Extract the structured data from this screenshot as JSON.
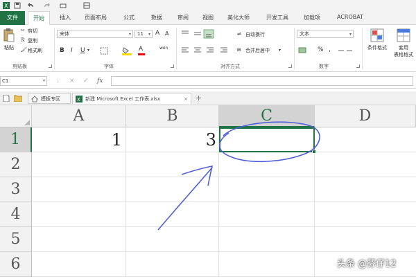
{
  "quick_access": {
    "save_icon": "save-icon",
    "undo_icon": "undo-icon",
    "redo_icon": "redo-icon",
    "extra_icon": "customize-icon"
  },
  "ribbon_tabs": [
    "文件",
    "开始",
    "插入",
    "页面布局",
    "公式",
    "数据",
    "审阅",
    "视图",
    "美化大师",
    "开发工具",
    "加载项",
    "ACROBAT"
  ],
  "clipboard": {
    "paste": "粘贴",
    "cut": "剪切",
    "copy": "复制",
    "format_painter": "格式刷",
    "group_label": "剪贴板"
  },
  "font": {
    "font_name": "宋体",
    "font_size": "11",
    "grow": "A",
    "shrink": "A",
    "bold": "B",
    "italic": "I",
    "underline": "U",
    "font_color_letter": "A",
    "phonetic": "wén",
    "group_label": "字体"
  },
  "alignment": {
    "wrap_text": "自动换行",
    "merge_center": "合并后居中",
    "group_label": "对齐方式"
  },
  "number": {
    "format": "文本",
    "percent": "%",
    "comma": ",",
    "group_label": "数字"
  },
  "styles": {
    "conditional_formatting": "条件格式",
    "table_format_line1": "套用",
    "table_format_line2": "表格格式"
  },
  "formula_bar": {
    "name_box": "C1",
    "fx": "fx",
    "cancel": "×",
    "enter": "✓"
  },
  "workbook_tabs": {
    "template_tab": "模板专区",
    "file_tab": "新建 Microsoft Excel 工作表.xlsx",
    "close": "×",
    "add": "+"
  },
  "columns": [
    "A",
    "B",
    "C",
    "D"
  ],
  "rows": [
    "1",
    "2",
    "3",
    "4",
    "5",
    "6"
  ],
  "cells": {
    "A1": "1",
    "B1": "3"
  },
  "selected_cell": "C1",
  "colors": {
    "accent": "#217346",
    "annotation": "#4f5fd8"
  },
  "watermark": "头条 @芬仔12"
}
